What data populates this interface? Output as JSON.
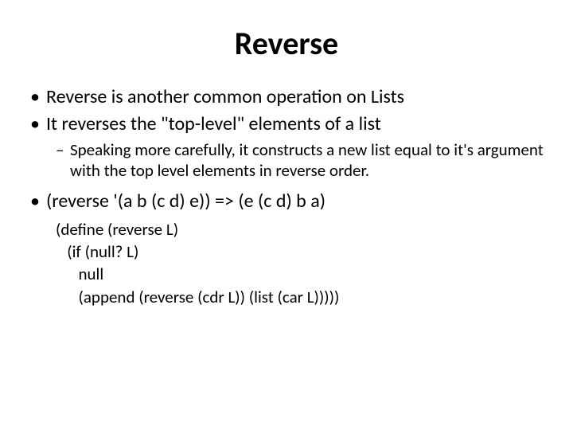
{
  "slide": {
    "title": "Reverse",
    "bullets": {
      "b1": "Reverse is another common operation on Lists",
      "b2": "It reverses the \"top-level\" elements of a list",
      "b2_sub": "Speaking more carefully, it constructs a new list equal to it's argument with the top level elements in reverse order.",
      "b3": "(reverse '(a b (c d) e)) => (e (c d) b a)"
    },
    "code": {
      "l1": "(define (reverse L)",
      "l2": "   (if (null? L)",
      "l3": "      null",
      "l4": "      (append (reverse (cdr L)) (list (car L)))))"
    }
  }
}
